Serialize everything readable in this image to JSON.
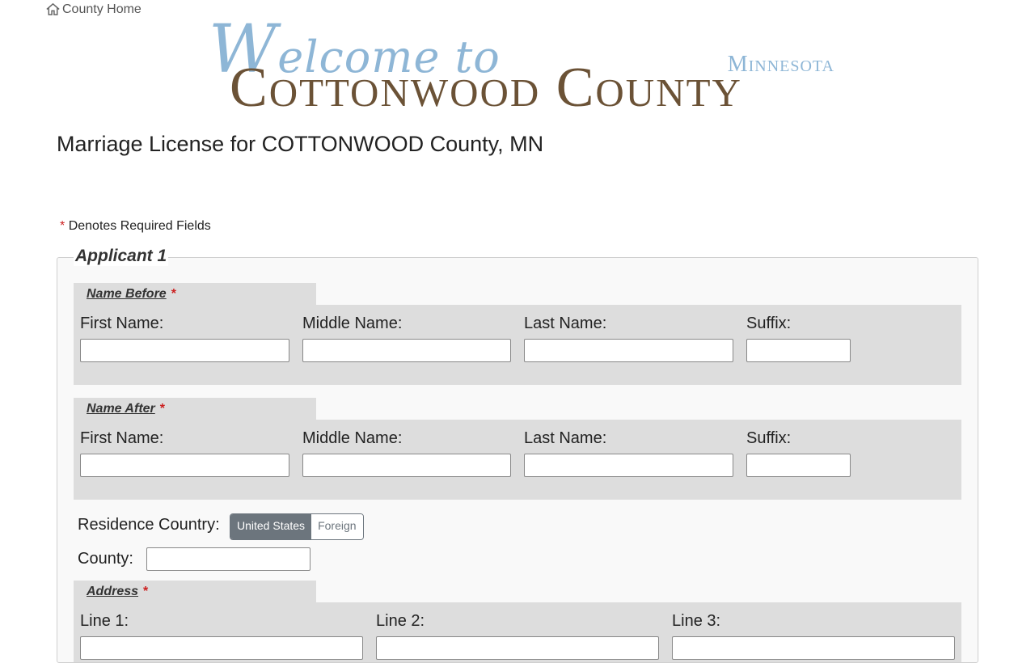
{
  "nav": {
    "home_label": "County Home"
  },
  "banner": {
    "welcome_first": "W",
    "welcome_rest": "elcome to",
    "county": "Cottonwood County",
    "state": "Minnesota"
  },
  "page": {
    "title": "Marriage License for COTTONWOOD County, MN"
  },
  "required_note": {
    "star": "*",
    "text": "Denotes Required Fields"
  },
  "applicant1": {
    "legend": "Applicant 1",
    "name_before": {
      "title": "Name Before",
      "star": "*",
      "first_label": "First Name:",
      "middle_label": "Middle Name:",
      "last_label": "Last Name:",
      "suffix_label": "Suffix:"
    },
    "name_after": {
      "title": "Name After",
      "star": "*",
      "first_label": "First Name:",
      "middle_label": "Middle Name:",
      "last_label": "Last Name:",
      "suffix_label": "Suffix:"
    },
    "residence": {
      "label": "Residence Country:",
      "options": [
        "United States",
        "Foreign"
      ],
      "selected": "United States"
    },
    "county": {
      "label": "County:",
      "value": ""
    },
    "address": {
      "title": "Address",
      "star": "*",
      "line1_label": "Line 1:",
      "line2_label": "Line 2:",
      "line3_label": "Line 3:"
    }
  },
  "colors": {
    "banner_blue": "#8eb6d6",
    "banner_brown": "#6b5236",
    "required_red": "#cc1f1f",
    "toggle_active": "#6c757d"
  }
}
